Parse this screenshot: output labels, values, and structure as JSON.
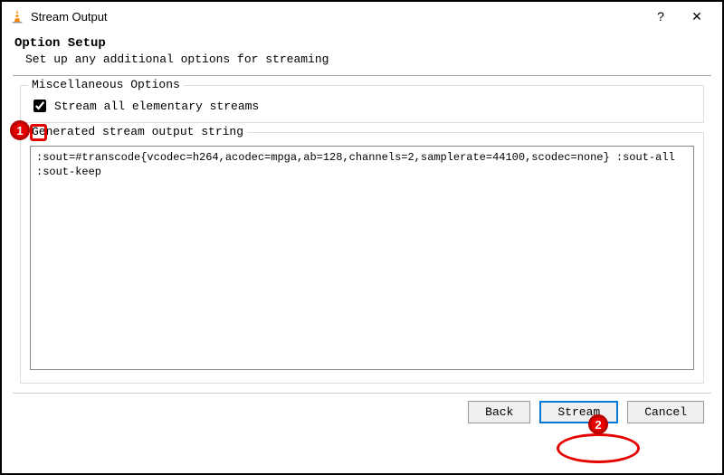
{
  "window": {
    "title": "Stream Output",
    "help_symbol": "?",
    "close_symbol": "✕"
  },
  "option_setup": {
    "heading": "Option Setup",
    "description": "Set up any additional options for streaming"
  },
  "misc": {
    "legend": "Miscellaneous Options",
    "checkbox_label": "Stream all elementary streams",
    "checked": true
  },
  "output_string": {
    "legend": "Generated stream output string",
    "value": ":sout=#transcode{vcodec=h264,acodec=mpga,ab=128,channels=2,samplerate=44100,scodec=none} :sout-all :sout-keep"
  },
  "buttons": {
    "back": "Back",
    "stream": "Stream",
    "cancel": "Cancel"
  },
  "annotations": {
    "marker1": "1",
    "marker2": "2"
  },
  "colors": {
    "annotation_red": "#e60000",
    "default_button_border": "#0178d7"
  }
}
